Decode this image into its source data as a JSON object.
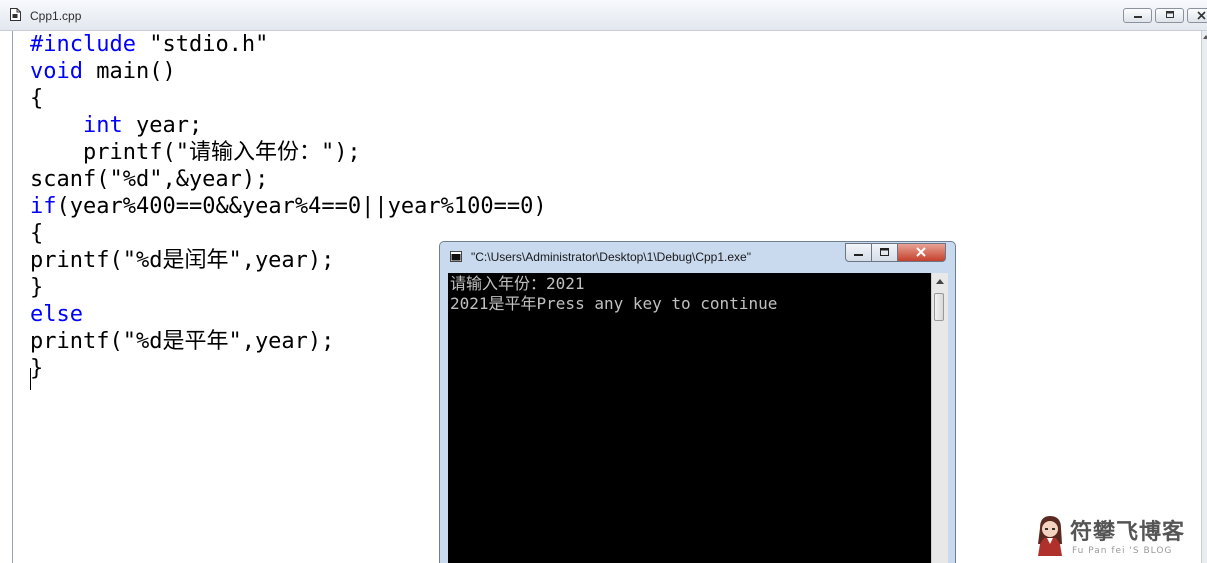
{
  "editor": {
    "tab_title": "Cpp1.cpp",
    "doc_icon": "document-icon",
    "controls": {
      "minimize_icon": "minimize-icon",
      "restore_icon": "restore-icon",
      "close_icon": "close-icon"
    },
    "code_lines": [
      {
        "keyword": "#include",
        "rest": " \"stdio.h\""
      },
      {
        "keyword": "void",
        "rest": " main()"
      },
      {
        "keyword": "",
        "rest": "{"
      },
      {
        "keyword": "int",
        "rest": " year;",
        "indent": "    "
      },
      {
        "keyword": "",
        "rest": "printf(\"请输入年份：\");",
        "indent": "    "
      },
      {
        "keyword": "",
        "rest": "scanf(\"%d\",&year);"
      },
      {
        "keyword": "if",
        "rest": "(year%400==0&&year%4==0||year%100==0)"
      },
      {
        "keyword": "",
        "rest": "{"
      },
      {
        "keyword": "",
        "rest": "printf(\"%d是闰年\",year);"
      },
      {
        "keyword": "",
        "rest": "}"
      },
      {
        "keyword": "else",
        "rest": ""
      },
      {
        "keyword": "",
        "rest": "printf(\"%d是平年\",year);"
      },
      {
        "keyword": "",
        "rest": "}"
      }
    ],
    "keyword_color": "#0000ff"
  },
  "console": {
    "title": "\"C:\\Users\\Administrator\\Desktop\\1\\Debug\\Cpp1.exe\"",
    "icon": "console-app-icon",
    "lines": [
      "请输入年份：2021",
      "2021是平年Press any key to continue"
    ],
    "background": "#000000",
    "text_color": "#c0c0c0",
    "controls": {
      "minimize_icon": "minimize-icon",
      "restore_icon": "restore-icon",
      "close_icon": "close-icon"
    }
  },
  "watermark": {
    "title": "符攀飞博客",
    "subtitle": "Fu Pan fei 'S BLOG",
    "avatar_icon": "avatar-icon"
  }
}
